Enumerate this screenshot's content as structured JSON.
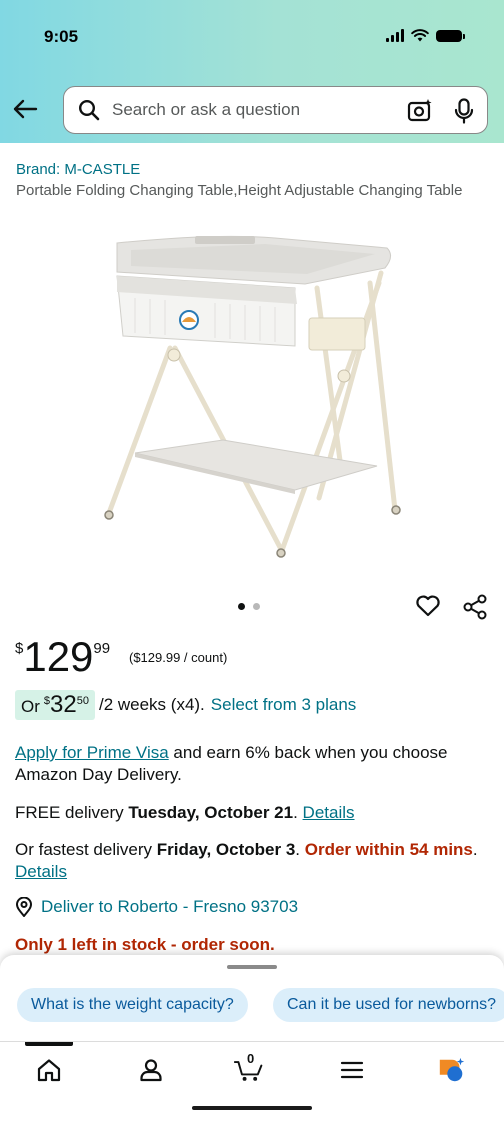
{
  "status_bar": {
    "time": "9:05"
  },
  "search": {
    "placeholder": "Search or ask a question"
  },
  "product": {
    "brand": "Brand: M-CASTLE",
    "title": "Portable Folding Changing Table,Height Adjustable Changing Table",
    "image_count": 2,
    "active_image": 1
  },
  "price": {
    "currency": "$",
    "whole": "129",
    "fraction": "99",
    "unit_price": "($129.99 / count)"
  },
  "installment": {
    "prefix": "Or",
    "currency": "$",
    "whole": "32",
    "fraction": "50",
    "terms": "/2 weeks (x4).",
    "link": "Select from 3 plans"
  },
  "prime_visa": {
    "link": "Apply for Prime Visa",
    "text": " and earn 6% back when you choose Amazon Day Delivery."
  },
  "delivery": {
    "free_prefix": "FREE delivery ",
    "free_date": "Tuesday, October 21",
    "free_suffix": ". ",
    "details_link": "Details",
    "fastest_prefix": "Or fastest delivery ",
    "fastest_date": "Friday, October 3",
    "fastest_suffix": ". ",
    "order_within": "Order within 54 mins",
    "after_order": ". ",
    "details_link_2": "Details",
    "deliver_to": "Deliver to Roberto - Fresno 93703"
  },
  "stock": "Only 1 left in stock - order soon.",
  "questions": [
    "What is the weight capacity?",
    "Can it be used for newborns?"
  ],
  "tabbar": {
    "cart_count": "0"
  },
  "colors": {
    "link": "#007185",
    "alert": "#b12704",
    "installment_badge": "#d6f2e7",
    "chip": "#dbeefa",
    "rufus_orange": "#f08a24",
    "rufus_blue": "#1f6fd1"
  }
}
